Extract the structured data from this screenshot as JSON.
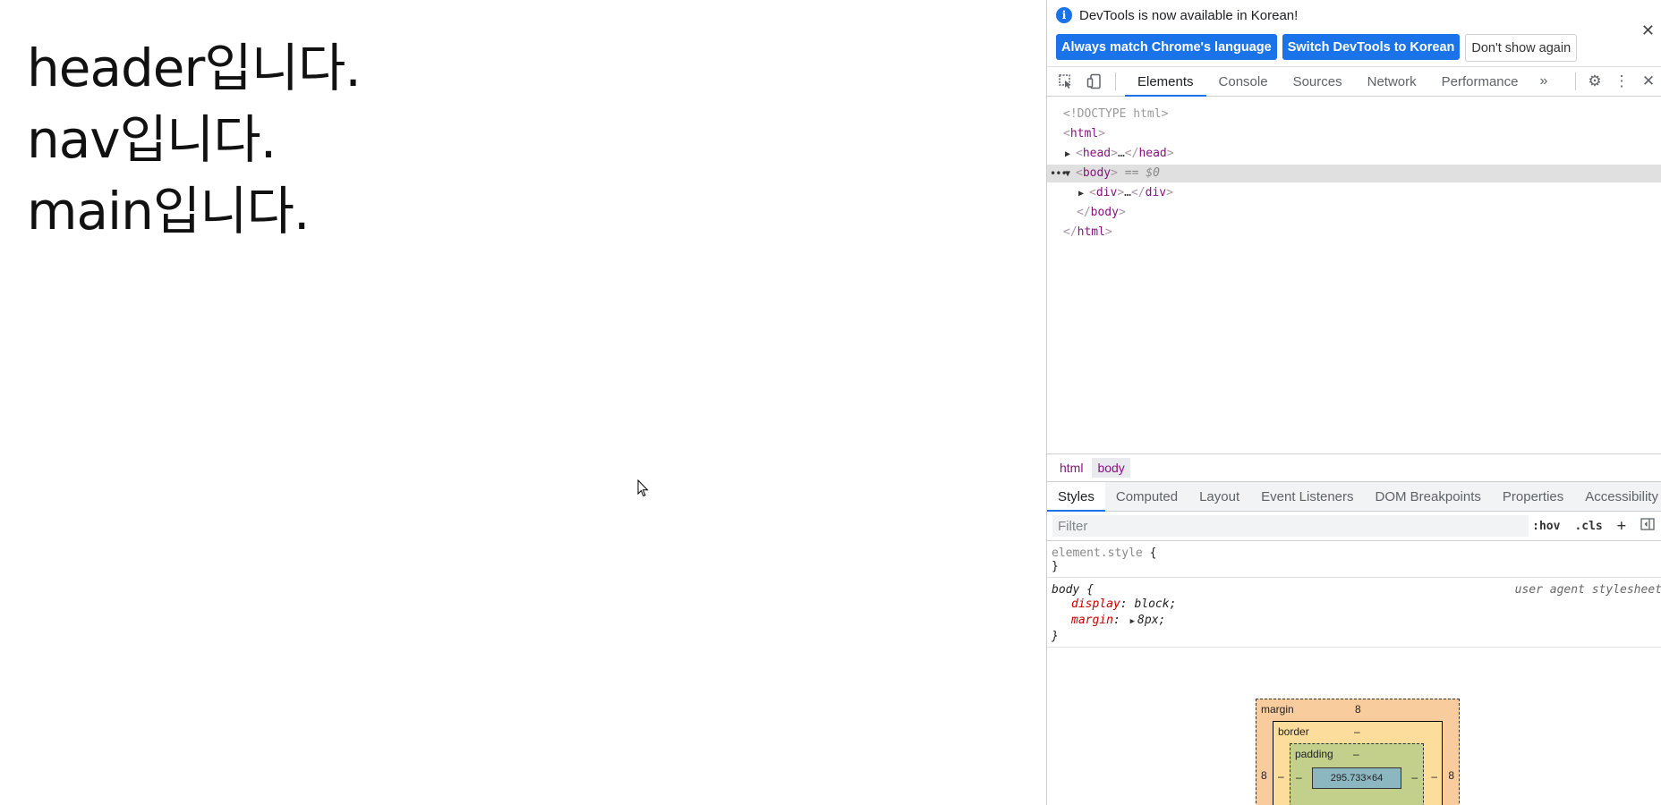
{
  "page": {
    "lines": [
      "header입니다.",
      "nav입니다.",
      "main입니다."
    ]
  },
  "devtools": {
    "infobar": {
      "message": "DevTools is now available in Korean!",
      "btn_match": "Always match Chrome's language",
      "btn_switch": "Switch DevTools to Korean",
      "btn_dont_show": "Don't show again"
    },
    "tabs": [
      "Elements",
      "Console",
      "Sources",
      "Network",
      "Performance"
    ],
    "dom": {
      "doctype": "<!DOCTYPE html>",
      "html_open": "html",
      "head": "head",
      "body": "body",
      "div": "div",
      "ellipsis": "…",
      "selected_marker": "== $0"
    },
    "breadcrumbs": [
      "html",
      "body"
    ],
    "panel_tabs": [
      "Styles",
      "Computed",
      "Layout",
      "Event Listeners",
      "DOM Breakpoints",
      "Properties",
      "Accessibility"
    ],
    "filter": {
      "placeholder": "Filter",
      "hov": ":hov",
      "cls": ".cls"
    },
    "styles": {
      "element_style": "element.style",
      "body_selector": "body",
      "ua_label": "user agent stylesheet",
      "decls": [
        {
          "prop": "display",
          "value": "block;"
        },
        {
          "prop": "margin",
          "value": "8px;"
        }
      ]
    },
    "box_model": {
      "margin_label": "margin",
      "margin_top": "8",
      "margin_left": "8",
      "margin_right": "8",
      "border_label": "border",
      "border_top": "–",
      "border_left": "–",
      "border_right": "–",
      "padding_label": "padding",
      "padding_top": "–",
      "padding_left": "–",
      "padding_right": "–",
      "padding_bottom": "–",
      "content": "295.733×64"
    }
  },
  "colors": {
    "accent": "#1a73e8",
    "tag": "#881280",
    "prop": "#c80000"
  }
}
